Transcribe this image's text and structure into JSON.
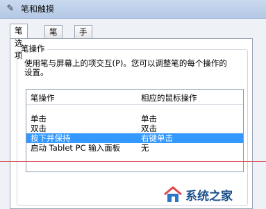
{
  "window": {
    "title": "笔和触摸"
  },
  "tabs": [
    {
      "label": "笔选项"
    },
    {
      "label": "笔势"
    },
    {
      "label": "手写"
    }
  ],
  "group": {
    "legend": "笔操作",
    "description_line1": "使用笔与屏幕上的项交互(P)。您可以调整笔的每个操作的",
    "description_line2": "设置。"
  },
  "list": {
    "headers": [
      "笔操作",
      "相应的鼠标操作"
    ],
    "rows": [
      {
        "action": "单击",
        "mouse": "单击"
      },
      {
        "action": "双击",
        "mouse": "双击"
      },
      {
        "action": "按下并保持",
        "mouse": "右键单击",
        "selected": true
      },
      {
        "action": "启动 Tablet PC 输入面板",
        "mouse": "无"
      }
    ]
  },
  "watermark": {
    "text": "系统之家"
  },
  "colors": {
    "selection": "#3399ff",
    "annotation_line": "#d8525a"
  }
}
